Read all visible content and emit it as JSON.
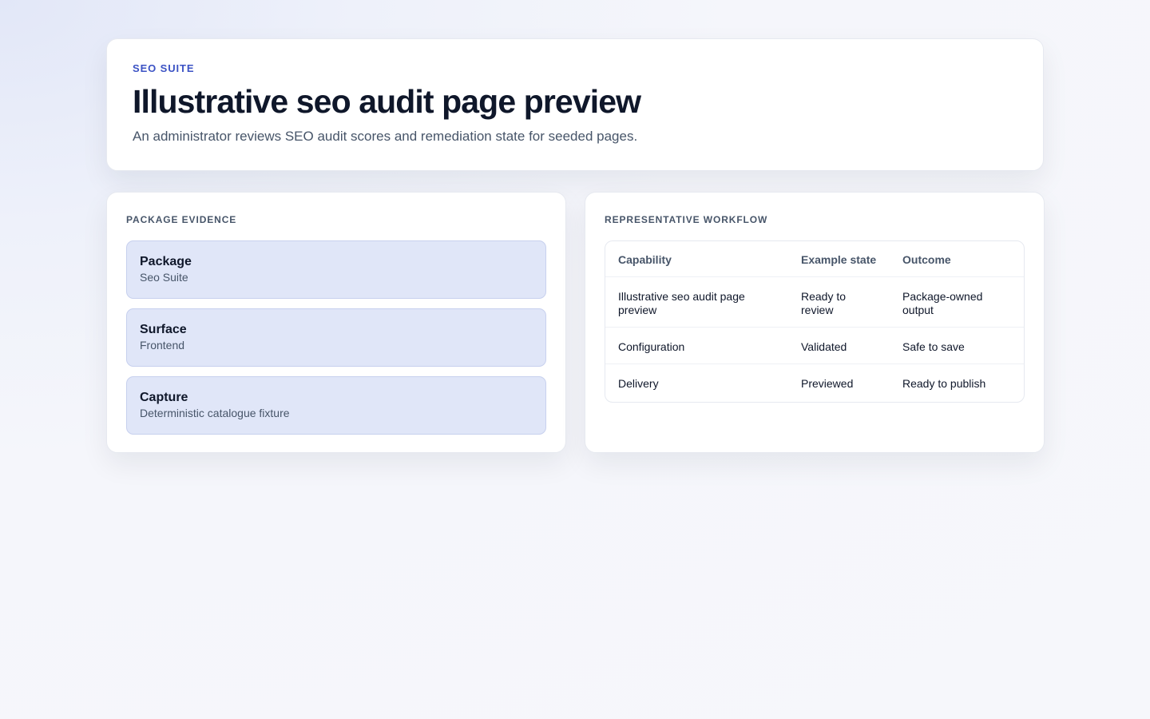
{
  "header": {
    "eyebrow": "SEO SUITE",
    "title": "Illustrative seo audit page preview",
    "subtitle": "An administrator reviews SEO audit scores and remediation state for seeded pages."
  },
  "evidence_panel": {
    "label": "PACKAGE EVIDENCE",
    "items": [
      {
        "title": "Package",
        "value": "Seo Suite"
      },
      {
        "title": "Surface",
        "value": "Frontend"
      },
      {
        "title": "Capture",
        "value": "Deterministic catalogue fixture"
      }
    ]
  },
  "workflow_panel": {
    "label": "REPRESENTATIVE WORKFLOW",
    "columns": [
      "Capability",
      "Example state",
      "Outcome"
    ],
    "rows": [
      [
        "Illustrative seo audit page preview",
        "Ready to review",
        "Package-owned output"
      ],
      [
        "Configuration",
        "Validated",
        "Safe to save"
      ],
      [
        "Delivery",
        "Previewed",
        "Ready to publish"
      ]
    ]
  }
}
